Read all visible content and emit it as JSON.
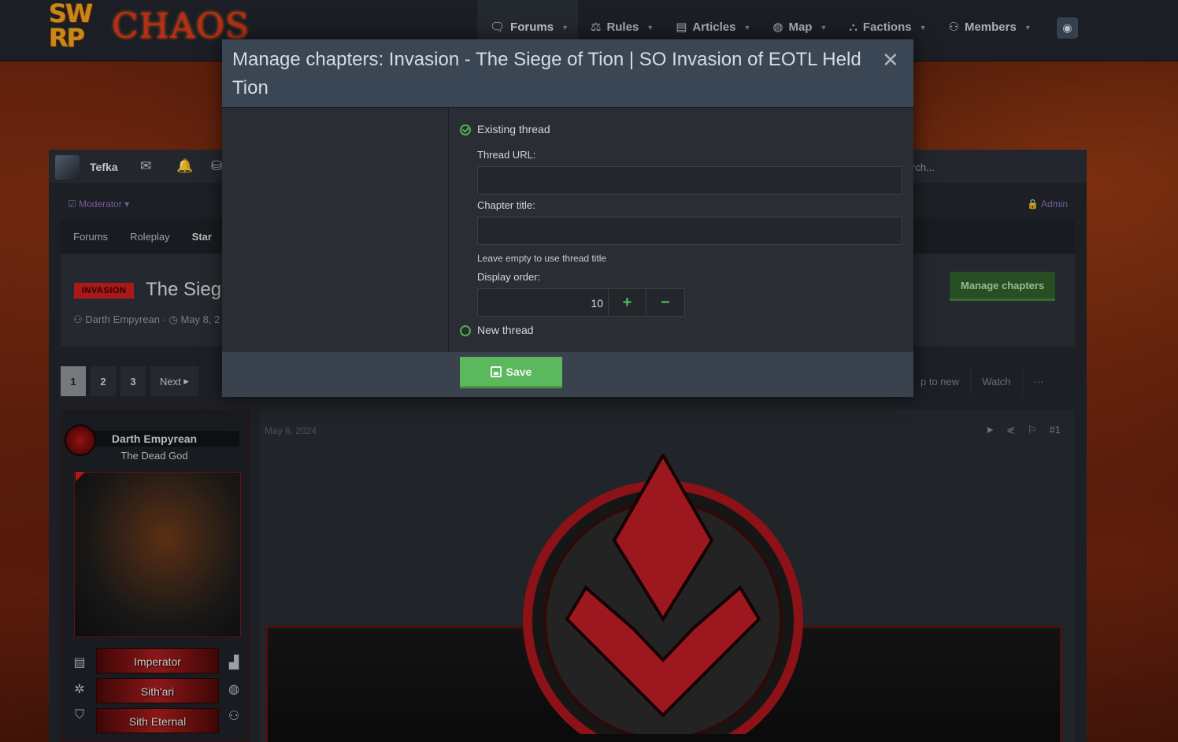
{
  "logo": {
    "top": "SW",
    "bottom": "RP",
    "name": "CHAOS"
  },
  "nav": {
    "items": [
      {
        "label": "Forums",
        "icon": "comments-icon",
        "glyph": "🗨",
        "active": true
      },
      {
        "label": "Rules",
        "icon": "scale-icon",
        "glyph": "⚖",
        "active": false
      },
      {
        "label": "Articles",
        "icon": "document-icon",
        "glyph": "▤",
        "active": false
      },
      {
        "label": "Map",
        "icon": "globe-icon",
        "glyph": "◍",
        "active": false
      },
      {
        "label": "Factions",
        "icon": "factions-icon",
        "glyph": "⛬",
        "active": false
      },
      {
        "label": "Members",
        "icon": "user-icon",
        "glyph": "⚇",
        "active": false
      }
    ],
    "discord_glyph": "◉"
  },
  "userbar": {
    "username": "Tefka",
    "search_placeholder": "rch..."
  },
  "modbar": {
    "moderator": "Moderator",
    "admin": "Admin"
  },
  "breadcrumbs": [
    "Forums",
    "Roleplay",
    "Star"
  ],
  "thread": {
    "prefix": "INVASION",
    "title": "The Siege",
    "author": "Darth Empyrean",
    "date_partial": "May 8, 2",
    "manage_chapters_label": "Manage chapters"
  },
  "pagination": {
    "pages": [
      "1",
      "2",
      "3"
    ],
    "current": "1",
    "next_label": "Next"
  },
  "thread_actions": [
    "p to new",
    "Watch",
    "···"
  ],
  "poster": {
    "name": "Darth Empyrean",
    "title": "The Dead God",
    "badges": [
      "Imperator",
      "Sith'ari",
      "Sith Eternal"
    ]
  },
  "post": {
    "date": "May 8, 2024",
    "number": "#1"
  },
  "modal": {
    "title": "Manage chapters: Invasion - The Siege of Tion | SO Invasion of EOTL Held Tion",
    "close_glyph": "✕",
    "option_existing": "Existing thread",
    "thread_url_label": "Thread URL:",
    "thread_url_value": "",
    "chapter_title_label": "Chapter title:",
    "chapter_title_value": "",
    "chapter_title_hint": "Leave empty to use thread title",
    "display_order_label": "Display order:",
    "display_order_value": "10",
    "increment_glyph": "+",
    "decrement_glyph": "−",
    "option_new": "New thread",
    "save_label": "Save"
  },
  "colors": {
    "accent_green": "#5cb85c",
    "modal_header": "#3b4654",
    "prefix_red": "#c71e1e"
  }
}
